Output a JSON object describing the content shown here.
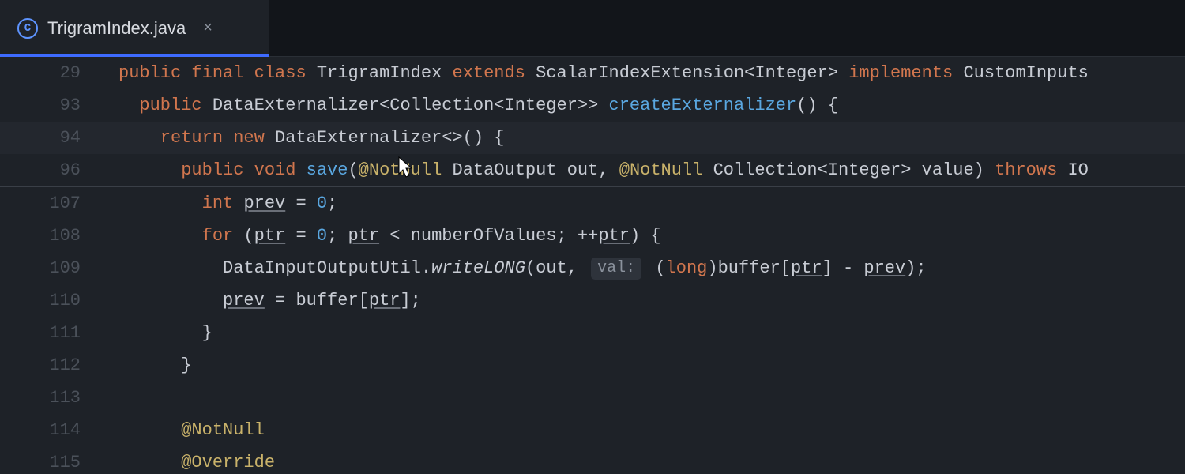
{
  "tab": {
    "icon_letter": "C",
    "title": "TrigramIndex.java"
  },
  "lines": {
    "l29": {
      "num": "29"
    },
    "l93": {
      "num": "93"
    },
    "l94": {
      "num": "94"
    },
    "l96": {
      "num": "96"
    },
    "l107": {
      "num": "107"
    },
    "l108": {
      "num": "108"
    },
    "l109": {
      "num": "109"
    },
    "l110": {
      "num": "110"
    },
    "l111": {
      "num": "111"
    },
    "l112": {
      "num": "112"
    },
    "l113": {
      "num": "113"
    },
    "l114": {
      "num": "114"
    },
    "l115": {
      "num": "115"
    }
  },
  "tok": {
    "public": "public",
    "final": "final",
    "class": "class",
    "extends": "extends",
    "implements": "implements",
    "return": "return",
    "new": "new",
    "void": "void",
    "throws": "throws",
    "int": "int",
    "for": "for",
    "long": "long",
    "TrigramIndex": "TrigramIndex",
    "ScalarIndexExtension": "ScalarIndexExtension",
    "Integer": "Integer",
    "CustomInputs": "CustomInputs",
    "DataExternalizer": "DataExternalizer",
    "Collection": "Collection",
    "createExternalizer": "createExternalizer",
    "save": "save",
    "NotNull": "@NotNull",
    "DataOutput": "DataOutput",
    "out": "out",
    "value": "value",
    "IO": "IO",
    "prev": "prev",
    "zero": "0",
    "ptr": "ptr",
    "numberOfValues": "numberOfValues",
    "DataInputOutputUtil": "DataInputOutputUtil",
    "writeLONG": "writeLONG",
    "valhint": "val:",
    "buffer": "buffer",
    "Override": "@Override"
  }
}
